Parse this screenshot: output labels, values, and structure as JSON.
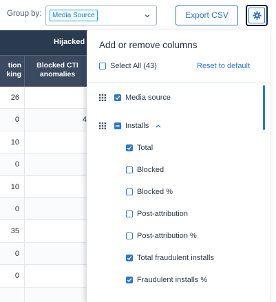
{
  "toolbar": {
    "group_by_label": "Group by:",
    "group_by_value": "Media Source",
    "export_label": "Export CSV",
    "settings_icon": "gear-icon"
  },
  "table": {
    "top_header": "Hijacked",
    "col1_header": [
      "tion",
      "king"
    ],
    "col2_header": [
      "Blocked CTI",
      "anomalies"
    ],
    "rows": [
      {
        "c1": "26",
        "c2": ""
      },
      {
        "c1": "0",
        "c2": "4"
      },
      {
        "c1": "10",
        "c2": ""
      },
      {
        "c1": "0",
        "c2": ""
      },
      {
        "c1": "10",
        "c2": ""
      },
      {
        "c1": "0",
        "c2": ""
      },
      {
        "c1": "35",
        "c2": ""
      },
      {
        "c1": "0",
        "c2": ""
      },
      {
        "c1": "0",
        "c2": ""
      },
      {
        "c1": "",
        "c2": ""
      }
    ]
  },
  "panel": {
    "title": "Add or remove columns",
    "select_all_label": "Select All (43)",
    "reset_label": "Reset to default",
    "groups": [
      {
        "label": "Media source",
        "checked": true,
        "indeterminate": false
      },
      {
        "label": "Installs",
        "checked": false,
        "indeterminate": true,
        "expanded": true
      }
    ],
    "installs_items": [
      {
        "label": "Total",
        "checked": true
      },
      {
        "label": "Blocked",
        "checked": false
      },
      {
        "label": "Blocked %",
        "checked": false
      },
      {
        "label": "Post-attribution",
        "checked": false
      },
      {
        "label": "Post-attribution %",
        "checked": false
      },
      {
        "label": "Total fraudulent installs",
        "checked": true
      },
      {
        "label": "Fraudulent installs %",
        "checked": true
      }
    ]
  },
  "colors": {
    "accent": "#2f77c7",
    "header_dark": "#2a3a4f",
    "header_mid": "#3b4a60",
    "chip_border": "#1ba7c9"
  }
}
